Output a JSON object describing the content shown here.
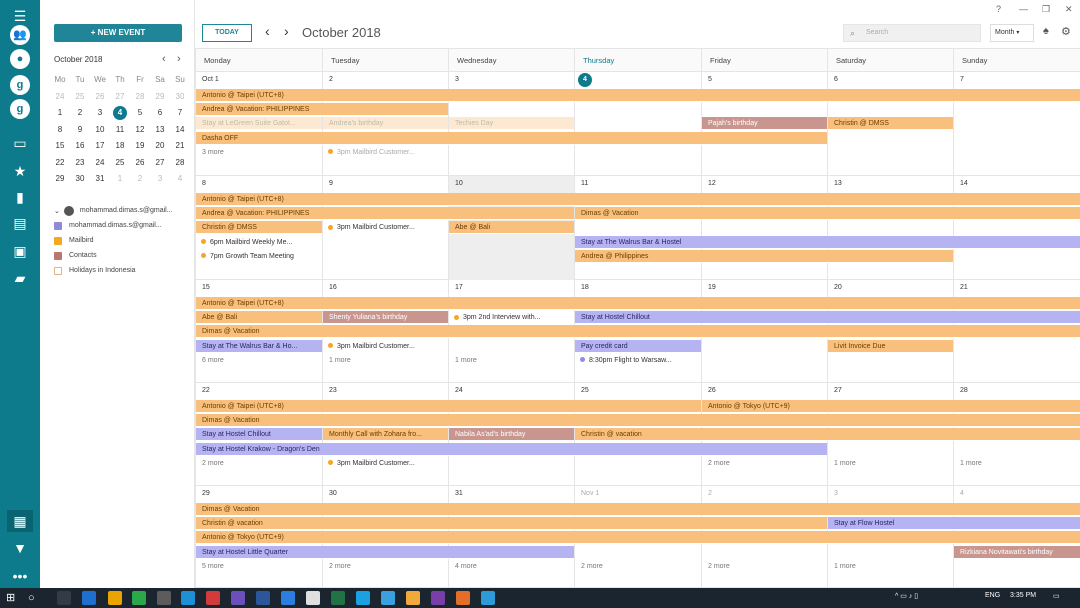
{
  "rail": [
    {
      "name": "menu-icon",
      "glyph": "☰"
    },
    {
      "name": "people-icon",
      "glyph": "👥",
      "cls": "acc"
    },
    {
      "name": "account-avatar",
      "glyph": "●",
      "cls": "acc"
    },
    {
      "name": "google-account-icon",
      "glyph": "g",
      "cls": "acc"
    },
    {
      "name": "google-account-icon-2",
      "glyph": "g",
      "cls": "acc"
    },
    {
      "name": "inbox-icon",
      "glyph": "▭"
    },
    {
      "name": "star-icon",
      "glyph": "★"
    },
    {
      "name": "document-icon",
      "glyph": "▮"
    },
    {
      "name": "archive-icon",
      "glyph": "▤"
    },
    {
      "name": "briefcase-icon",
      "glyph": "▣"
    },
    {
      "name": "folder-icon",
      "glyph": "▰"
    },
    {
      "name": "calendar-app-icon",
      "glyph": "▦",
      "cls": "sel"
    },
    {
      "name": "bookmark-icon",
      "glyph": "▼"
    },
    {
      "name": "more-icon",
      "glyph": "•••"
    }
  ],
  "sidebar": {
    "new_event": "+ NEW EVENT",
    "month_title": "October 2018",
    "weekdays": [
      "Mo",
      "Tu",
      "We",
      "Th",
      "Fr",
      "Sa",
      "Su"
    ],
    "weeks": [
      [
        "24",
        "25",
        "26",
        "27",
        "28",
        "29",
        "30"
      ],
      [
        "1",
        "2",
        "3",
        "4",
        "5",
        "6",
        "7"
      ],
      [
        "8",
        "9",
        "10",
        "11",
        "12",
        "13",
        "14"
      ],
      [
        "15",
        "16",
        "17",
        "18",
        "19",
        "20",
        "21"
      ],
      [
        "22",
        "23",
        "24",
        "25",
        "26",
        "27",
        "28"
      ],
      [
        "29",
        "30",
        "31",
        "1",
        "2",
        "3",
        "4"
      ]
    ],
    "account": "mohammad.dimas.s@gmail...",
    "calendars": [
      {
        "label": "mohammad.dimas.s@gmail...",
        "color": "#8e8ad8"
      },
      {
        "label": "Mailbird",
        "color": "#f5a623"
      },
      {
        "label": "Contacts",
        "color": "#b87770"
      },
      {
        "label": "Holidays in Indonesia",
        "color": "#ffffff"
      }
    ]
  },
  "toolbar": {
    "today": "TODAY",
    "title": "October 2018",
    "search_placeholder": "Search",
    "view": "Month"
  },
  "window": {
    "help": "?",
    "minimize": "—",
    "restore": "❐",
    "close": "✕"
  },
  "day_headers": [
    "Monday",
    "Tuesday",
    "Wednesday",
    "Thursday",
    "Friday",
    "Saturday",
    "Sunday"
  ],
  "weeks": [
    {
      "days": [
        "Oct 1",
        "2",
        "3",
        "4",
        "5",
        "6",
        "7"
      ],
      "bars": [
        {
          "t": "Antonio @ Taipei (UTC+8)",
          "s": 0,
          "e": 7,
          "r": 0,
          "c": "o"
        },
        {
          "t": "Andrea @ Vacation: PHILIPPINES",
          "s": 0,
          "e": 2,
          "r": 1,
          "c": "o"
        },
        {
          "t": "Stay at LeGreen Suite Gatot...",
          "s": 0,
          "e": 1,
          "r": 2,
          "c": "f"
        },
        {
          "t": "Andrea's birthday",
          "s": 1,
          "e": 2,
          "r": 2,
          "c": "f"
        },
        {
          "t": "Techies Day",
          "s": 2,
          "e": 3,
          "r": 2,
          "c": "f"
        },
        {
          "t": "Pajah's birthday",
          "s": 4,
          "e": 5,
          "r": 2,
          "c": "b"
        },
        {
          "t": "Christin @ DMSS",
          "s": 5,
          "e": 6,
          "r": 2,
          "c": "o"
        },
        {
          "t": "Dasha OFF",
          "s": 0,
          "e": 5,
          "r": 3,
          "c": "o"
        }
      ],
      "items": [
        {
          "t": "3 more",
          "d": 0,
          "r": 4,
          "k": "more"
        },
        {
          "t": "3pm Mailbird Customer...",
          "d": 1,
          "r": 4,
          "k": "ev",
          "f": true
        }
      ]
    },
    {
      "days": [
        "8",
        "9",
        "10",
        "11",
        "12",
        "13",
        "14"
      ],
      "bars": [
        {
          "t": "Antonio @ Taipei (UTC+8)",
          "s": 0,
          "e": 7,
          "r": 0,
          "c": "o"
        },
        {
          "t": "Andrea @ Vacation: PHILIPPINES",
          "s": 0,
          "e": 3,
          "r": 1,
          "c": "o"
        },
        {
          "t": "Dimas @ Vacation",
          "s": 3,
          "e": 7,
          "r": 1,
          "c": "o"
        },
        {
          "t": "Christin @ DMSS",
          "s": 0,
          "e": 1,
          "r": 2,
          "c": "o"
        },
        {
          "t": "Abe @ Bali",
          "s": 2,
          "e": 3,
          "r": 2,
          "c": "o"
        },
        {
          "t": "Stay at The Walrus Bar & Hostel",
          "s": 3,
          "e": 7,
          "r": 3,
          "c": "p"
        },
        {
          "t": "Andrea @ Philippines",
          "s": 3,
          "e": 6,
          "r": 4,
          "c": "o"
        }
      ],
      "items": [
        {
          "t": "3pm Mailbird Customer...",
          "d": 1,
          "r": 2,
          "k": "ev"
        },
        {
          "t": "6pm Mailbird Weekly Me...",
          "d": 0,
          "r": 3,
          "k": "ev"
        },
        {
          "t": "7pm Growth Team Meeting",
          "d": 0,
          "r": 4,
          "k": "ev"
        }
      ]
    },
    {
      "days": [
        "15",
        "16",
        "17",
        "18",
        "19",
        "20",
        "21"
      ],
      "bars": [
        {
          "t": "Antonio @ Taipei (UTC+8)",
          "s": 0,
          "e": 7,
          "r": 0,
          "c": "o"
        },
        {
          "t": "Abe @ Bali",
          "s": 0,
          "e": 1,
          "r": 1,
          "c": "o"
        },
        {
          "t": "Shenty Yuliana's birthday",
          "s": 1,
          "e": 2,
          "r": 1,
          "c": "b"
        },
        {
          "t": "Stay at Hostel Chillout",
          "s": 3,
          "e": 7,
          "r": 1,
          "c": "p"
        },
        {
          "t": "Dimas @ Vacation",
          "s": 0,
          "e": 7,
          "r": 2,
          "c": "o"
        },
        {
          "t": "Stay at The Walrus Bar & Ho...",
          "s": 0,
          "e": 1,
          "r": 3,
          "c": "p"
        },
        {
          "t": "Pay credit card",
          "s": 3,
          "e": 4,
          "r": 3,
          "c": "p"
        },
        {
          "t": "Livit Invoice Due",
          "s": 5,
          "e": 6,
          "r": 3,
          "c": "o"
        }
      ],
      "items": [
        {
          "t": "3pm 2nd Interview with...",
          "d": 2,
          "r": 1,
          "k": "ev"
        },
        {
          "t": "3pm Mailbird Customer...",
          "d": 1,
          "r": 3,
          "k": "ev"
        },
        {
          "t": "6 more",
          "d": 0,
          "r": 4,
          "k": "more"
        },
        {
          "t": "1 more",
          "d": 1,
          "r": 4,
          "k": "more"
        },
        {
          "t": "1 more",
          "d": 2,
          "r": 4,
          "k": "more"
        },
        {
          "t": "8:30pm Flight to Warsaw...",
          "d": 3,
          "r": 4,
          "k": "ev",
          "p": true
        }
      ]
    },
    {
      "days": [
        "22",
        "23",
        "24",
        "25",
        "26",
        "27",
        "28"
      ],
      "bars": [
        {
          "t": "Antonio @ Taipei (UTC+8)",
          "s": 0,
          "e": 4,
          "r": 0,
          "c": "o"
        },
        {
          "t": "Antonio @ Tokyo (UTC+9)",
          "s": 4,
          "e": 7,
          "r": 0,
          "c": "o"
        },
        {
          "t": "Dimas @ Vacation",
          "s": 0,
          "e": 7,
          "r": 1,
          "c": "o"
        },
        {
          "t": "Stay at Hostel Chillout",
          "s": 0,
          "e": 1,
          "r": 2,
          "c": "p"
        },
        {
          "t": "Monthly Call with Zohara fro...",
          "s": 1,
          "e": 2,
          "r": 2,
          "c": "o"
        },
        {
          "t": "Nabila As'ad's birthday",
          "s": 2,
          "e": 3,
          "r": 2,
          "c": "b"
        },
        {
          "t": "Christin @ vacation",
          "s": 3,
          "e": 7,
          "r": 2,
          "c": "o"
        },
        {
          "t": "Stay at Hostel Krakow - Dragon's Den",
          "s": 0,
          "e": 5,
          "r": 3,
          "c": "p"
        }
      ],
      "items": [
        {
          "t": "2 more",
          "d": 0,
          "r": 4,
          "k": "more"
        },
        {
          "t": "3pm Mailbird Customer...",
          "d": 1,
          "r": 4,
          "k": "ev"
        },
        {
          "t": "2 more",
          "d": 4,
          "r": 4,
          "k": "more"
        },
        {
          "t": "1 more",
          "d": 5,
          "r": 4,
          "k": "more"
        },
        {
          "t": "1 more",
          "d": 6,
          "r": 4,
          "k": "more"
        }
      ]
    },
    {
      "days": [
        "29",
        "30",
        "31",
        "Nov 1",
        "2",
        "3",
        "4"
      ],
      "bars": [
        {
          "t": "Dimas @ Vacation",
          "s": 0,
          "e": 7,
          "r": 0,
          "c": "o"
        },
        {
          "t": "Christin @ vacation",
          "s": 0,
          "e": 5,
          "r": 1,
          "c": "o"
        },
        {
          "t": "Stay at Flow Hostel",
          "s": 5,
          "e": 7,
          "r": 1,
          "c": "p"
        },
        {
          "t": "Antonio @ Tokyo (UTC+9)",
          "s": 0,
          "e": 7,
          "r": 2,
          "c": "o"
        },
        {
          "t": "Stay at Hostel Little Quarter",
          "s": 0,
          "e": 3,
          "r": 3,
          "c": "p"
        },
        {
          "t": "Rizkiana Novitawati's birthday",
          "s": 6,
          "e": 7,
          "r": 3,
          "c": "b"
        }
      ],
      "items": [
        {
          "t": "5 more",
          "d": 0,
          "r": 4,
          "k": "more"
        },
        {
          "t": "2 more",
          "d": 1,
          "r": 4,
          "k": "more"
        },
        {
          "t": "4 more",
          "d": 2,
          "r": 4,
          "k": "more"
        },
        {
          "t": "2 more",
          "d": 3,
          "r": 4,
          "k": "more"
        },
        {
          "t": "2 more",
          "d": 4,
          "r": 4,
          "k": "more"
        },
        {
          "t": "1 more",
          "d": 5,
          "r": 4,
          "k": "more"
        }
      ]
    }
  ],
  "taskbar": {
    "lang": "ENG",
    "time": "3:35 PM"
  },
  "taskbar_icons": [
    "#ffffff",
    "#333b44",
    "#1e6fcf",
    "#e9a400",
    "#2aa84a",
    "#5c5c5c",
    "#1e90d6",
    "#d23b3b",
    "#6b4fbb",
    "#2b579a",
    "#2b7de0",
    "#e0e0e0",
    "#217346",
    "#1aa1e0",
    "#3aa0e0",
    "#f2a93b",
    "#7a3ea8",
    "#e26e2a",
    "#2f9ad8"
  ]
}
